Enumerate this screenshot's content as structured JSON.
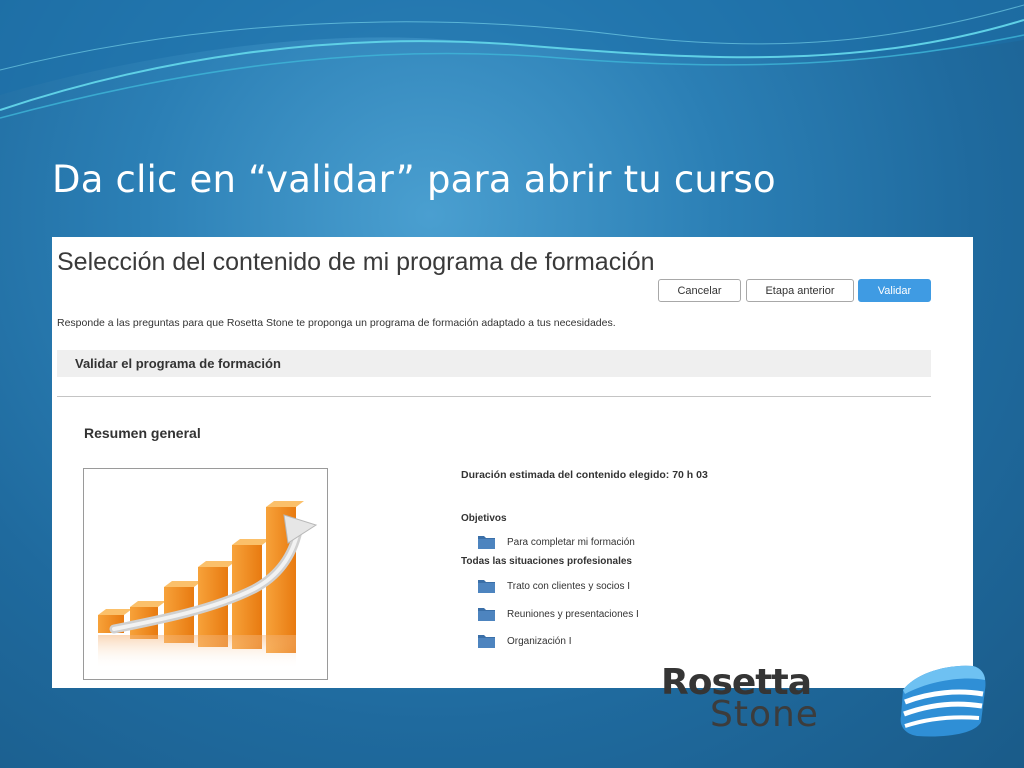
{
  "slide": {
    "title": "Da clic en “validar” para abrir tu curso"
  },
  "panel": {
    "title": "Selección del contenido de mi programa de formación",
    "buttons": {
      "cancel": "Cancelar",
      "previous": "Etapa anterior",
      "validate": "Validar"
    },
    "intro": "Responde a las preguntas para que Rosetta Stone te proponga un programa de formación adaptado a tus necesidades.",
    "section_title": "Validar el programa de formación",
    "summary_title": "Resumen general",
    "duration": "Duración estimada del contenido elegido: 70 h 03",
    "objectives": {
      "label": "Objetivos",
      "items": [
        "Para completar mi formación"
      ]
    },
    "situations": {
      "label": "Todas las situaciones profesionales",
      "items": [
        "Trato con clientes y socios I",
        "Reuniones y presentaciones I",
        "Organización I"
      ]
    }
  },
  "logo": {
    "line1": "Rosetta",
    "line2": "Stone"
  },
  "colors": {
    "accent": "#3f9be3",
    "folder": "#3a6fa8",
    "chart_orange": "#f08a1c"
  },
  "icons": {
    "folder": "folder-icon",
    "chart": "growth-chart-illustration"
  }
}
